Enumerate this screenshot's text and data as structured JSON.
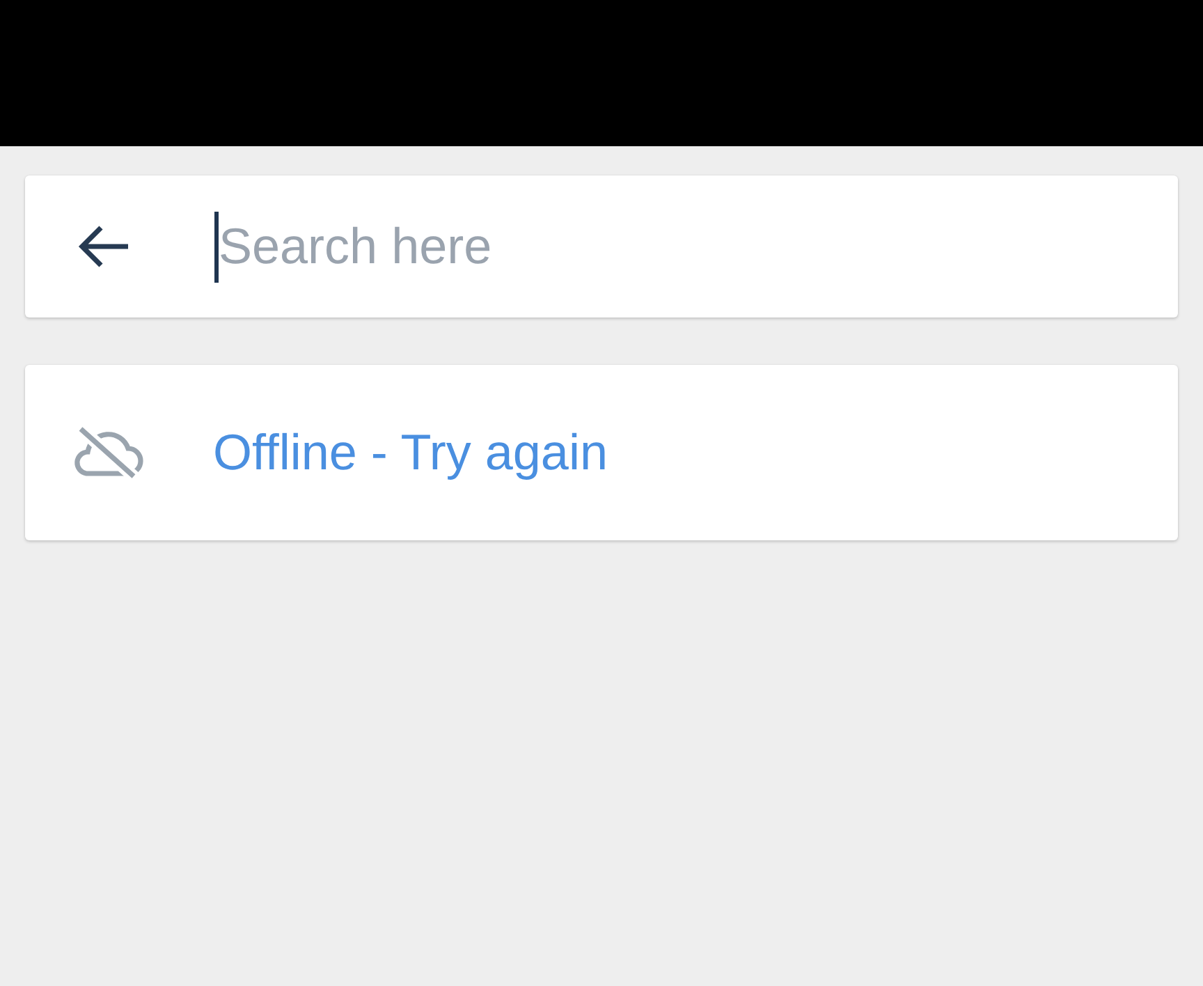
{
  "search": {
    "placeholder": "Search here",
    "focused": true
  },
  "offline_notice": {
    "label": "Offline - Try again"
  }
}
